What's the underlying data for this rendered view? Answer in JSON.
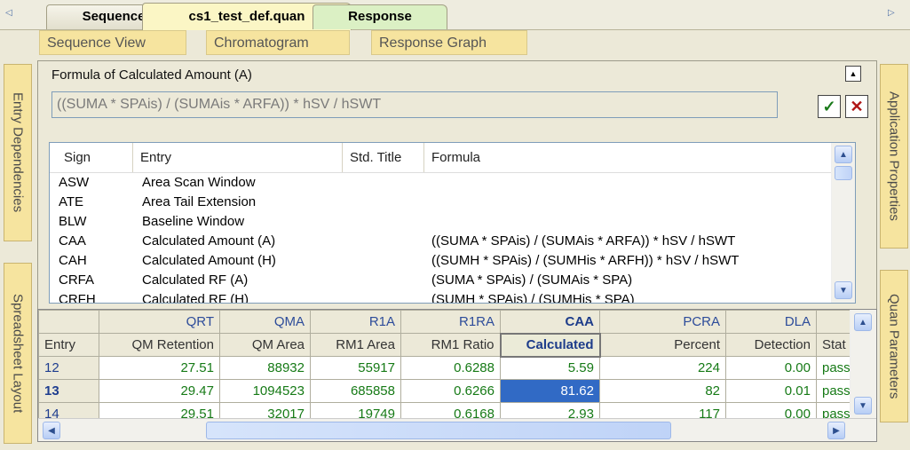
{
  "doc_tabs": [
    "Sequence",
    "cs1_test_def.quan",
    "Response"
  ],
  "view_tabs": [
    "Sequence View",
    "Chromatogram",
    "Response Graph"
  ],
  "left_tabs": [
    "Entry Dependencies",
    "Spreadsheet Layout"
  ],
  "right_tabs": [
    "Application Properties",
    "Quan Parameters"
  ],
  "formula": {
    "label": "Formula of Calculated Amount (A)",
    "value": "((SUMA * SPAis) / (SUMAis * ARFA)) * hSV / hSWT"
  },
  "entry_list": {
    "columns": [
      "Sign",
      "Entry",
      "Std. Title",
      "Formula"
    ],
    "rows": [
      {
        "sign": "ASW",
        "entry": "Area Scan Window",
        "formula": ""
      },
      {
        "sign": "ATE",
        "entry": "Area Tail Extension",
        "formula": ""
      },
      {
        "sign": "BLW",
        "entry": "Baseline Window",
        "formula": ""
      },
      {
        "sign": "CAA",
        "entry": "Calculated Amount (A)",
        "formula": "((SUMA * SPAis) / (SUMAis * ARFA)) * hSV / hSWT"
      },
      {
        "sign": "CAH",
        "entry": "Calculated Amount (H)",
        "formula": "((SUMH * SPAis) / (SUMHis * ARFH)) * hSV / hSWT"
      },
      {
        "sign": "CRFA",
        "entry": "Calculated RF (A)",
        "formula": "(SUMA * SPAis) / (SUMAis * SPA)"
      },
      {
        "sign": "CRFH",
        "entry": "Calculated RF (H)",
        "formula": "(SUMH * SPAis) / (SUMHis * SPA)"
      }
    ]
  },
  "grid": {
    "codes": [
      "",
      "QRT",
      "QMA",
      "R1A",
      "R1RA",
      "CAA",
      "PCRA",
      "DLA",
      ""
    ],
    "titles": [
      "Entry",
      "QM Retention",
      "QM Area",
      "RM1 Area",
      "RM1 Ratio",
      "Calculated",
      "Percent",
      "Detection",
      "Stat"
    ],
    "rows": [
      {
        "entry": "12",
        "values": [
          "27.51",
          "88932",
          "55917",
          "0.6288",
          "5.59",
          "224",
          "0.00",
          "pass"
        ]
      },
      {
        "entry": "13",
        "values": [
          "29.47",
          "1094523",
          "685858",
          "0.6266",
          "81.62",
          "82",
          "0.01",
          "pass"
        ]
      },
      {
        "entry": "14",
        "values": [
          "29.51",
          "32017",
          "19749",
          "0.6168",
          "2.93",
          "117",
          "0.00",
          "pass"
        ]
      }
    ],
    "selected_row": "13",
    "selected_column": "CAA"
  },
  "colors": {
    "value_green": "#167a16",
    "selection_blue": "#316ac5",
    "tab_yellow": "#f6e49f"
  }
}
